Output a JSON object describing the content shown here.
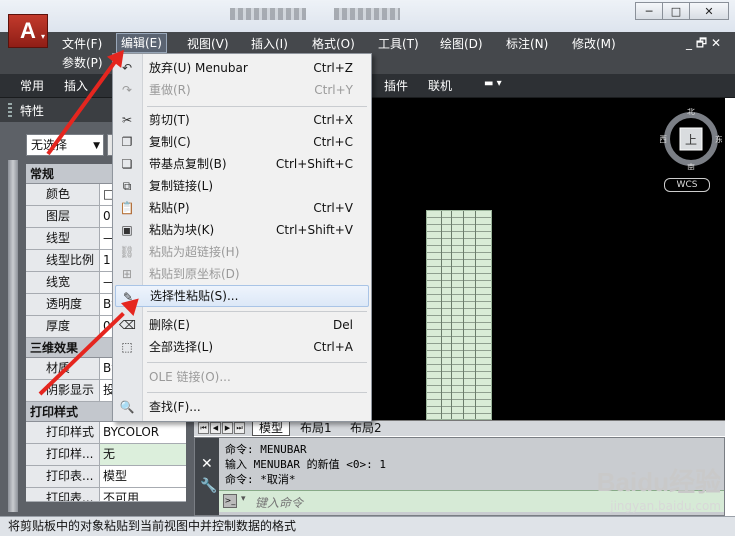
{
  "window_controls": {
    "minimize": "─",
    "maximize": "□",
    "close": "✕"
  },
  "app_logo": {
    "letter": "A",
    "arrow": "▾"
  },
  "menubar": {
    "items": [
      "文件(F)",
      "编辑(E)",
      "视图(V)",
      "插入(I)",
      "格式(O)",
      "工具(T)",
      "绘图(D)",
      "标注(N)",
      "修改(M)"
    ],
    "second_row": "参数(P)",
    "mdi_controls": "_ 🗗 ✕"
  },
  "ribbon_tabs": [
    "常用",
    "插入",
    "插件",
    "联机"
  ],
  "palette": {
    "title": "特性",
    "selector": "无选择",
    "sections": [
      {
        "name": "常规",
        "rows": [
          {
            "k": "颜色",
            "v": "□"
          },
          {
            "k": "图层",
            "v": "0"
          },
          {
            "k": "线型",
            "v": "—"
          },
          {
            "k": "线型比例",
            "v": "1"
          },
          {
            "k": "线宽",
            "v": "—"
          },
          {
            "k": "透明度",
            "v": "By"
          },
          {
            "k": "厚度",
            "v": "0"
          }
        ]
      },
      {
        "name": "三维效果",
        "rows": [
          {
            "k": "材质",
            "v": "By"
          },
          {
            "k": "阴影显示",
            "v": "投"
          }
        ]
      },
      {
        "name": "打印样式",
        "rows": [
          {
            "k": "打印样式",
            "v": "BYCOLOR"
          },
          {
            "k": "打印样...",
            "v": "无"
          },
          {
            "k": "打印表...",
            "v": "模型"
          },
          {
            "k": "打印表...",
            "v": "不可用"
          }
        ]
      }
    ]
  },
  "viewcube": {
    "north": "北",
    "south": "南",
    "west": "西",
    "east": "东",
    "face": "上",
    "wcs": "WCS"
  },
  "layout_tabs": [
    "模型",
    "布局1",
    "布局2"
  ],
  "command": {
    "history": [
      "命令: MENUBAR",
      "输入 MENUBAR 的新值 <0>: 1",
      "命令: *取消*"
    ],
    "placeholder": "键入命令"
  },
  "status": "将剪贴板中的对象粘贴到当前视图中并控制数据的格式",
  "watermark": {
    "big": "Baidu经验",
    "small": "jingyan.baidu.com"
  },
  "edit_menu": {
    "items": [
      {
        "label": "放弃(U) Menubar",
        "shortcut": "Ctrl+Z",
        "icon": "↶",
        "disabled": false
      },
      {
        "label": "重做(R)",
        "shortcut": "Ctrl+Y",
        "icon": "↷",
        "disabled": true
      },
      {
        "label": "剪切(T)",
        "shortcut": "Ctrl+X",
        "icon": "✂",
        "disabled": false
      },
      {
        "label": "复制(C)",
        "shortcut": "Ctrl+C",
        "icon": "❐",
        "disabled": false
      },
      {
        "label": "带基点复制(B)",
        "shortcut": "Ctrl+Shift+C",
        "icon": "❏",
        "disabled": false
      },
      {
        "label": "复制链接(L)",
        "shortcut": "",
        "icon": "⧉",
        "disabled": false
      },
      {
        "label": "粘贴(P)",
        "shortcut": "Ctrl+V",
        "icon": "📋",
        "disabled": false
      },
      {
        "label": "粘贴为块(K)",
        "shortcut": "Ctrl+Shift+V",
        "icon": "▣",
        "disabled": false
      },
      {
        "label": "粘贴为超链接(H)",
        "shortcut": "",
        "icon": "⛓",
        "disabled": true
      },
      {
        "label": "粘贴到原坐标(D)",
        "shortcut": "",
        "icon": "⊞",
        "disabled": true
      },
      {
        "label": "选择性粘贴(S)...",
        "shortcut": "",
        "icon": "✎",
        "disabled": false
      },
      {
        "label": "删除(E)",
        "shortcut": "Del",
        "icon": "⌫",
        "disabled": false
      },
      {
        "label": "全部选择(L)",
        "shortcut": "Ctrl+A",
        "icon": "⬚",
        "disabled": false
      },
      {
        "label": "OLE 链接(O)...",
        "shortcut": "",
        "icon": "",
        "disabled": true
      },
      {
        "label": "查找(F)...",
        "shortcut": "",
        "icon": "🔍",
        "disabled": false
      }
    ]
  }
}
